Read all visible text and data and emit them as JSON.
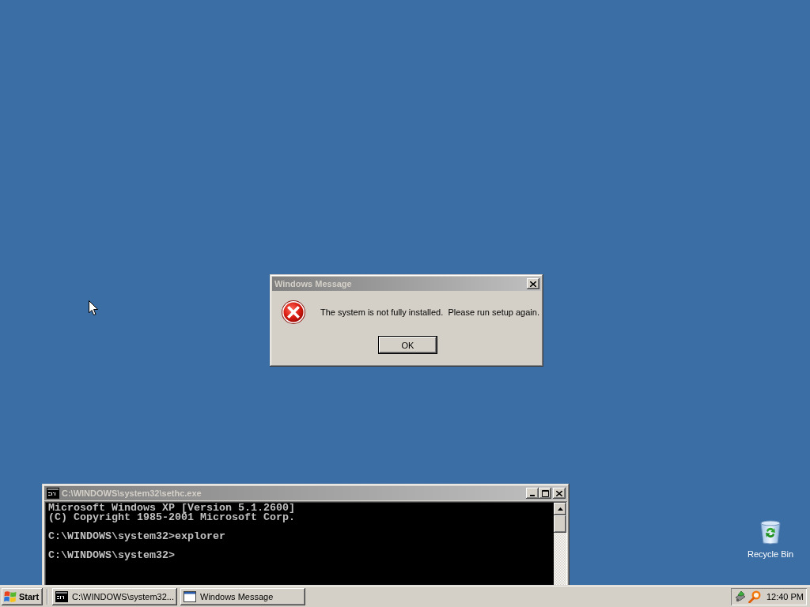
{
  "dialog": {
    "title": "Windows Message",
    "active": false,
    "message": "The system is not fully installed.  Please run setup again.",
    "buttons": [
      "OK"
    ]
  },
  "console": {
    "title": "C:\\WINDOWS\\system32\\sethc.exe",
    "active": false,
    "blocks": [
      [
        "Microsoft Windows XP [Version 5.1.2600]",
        "(C) Copyright 1985-2001 Microsoft Corp."
      ],
      [
        "C:\\WINDOWS\\system32>explorer"
      ],
      [
        "C:\\WINDOWS\\system32>"
      ]
    ]
  },
  "desktop": {
    "icons": [
      {
        "label": "Recycle Bin"
      }
    ]
  },
  "taskbar": {
    "start_label": "Start",
    "tasks": [
      {
        "label": "C:\\WINDOWS\\system32...",
        "kind": "console",
        "selected": false
      },
      {
        "label": "Windows Message",
        "kind": "window",
        "selected": false
      }
    ],
    "clock": "12:40 PM"
  }
}
